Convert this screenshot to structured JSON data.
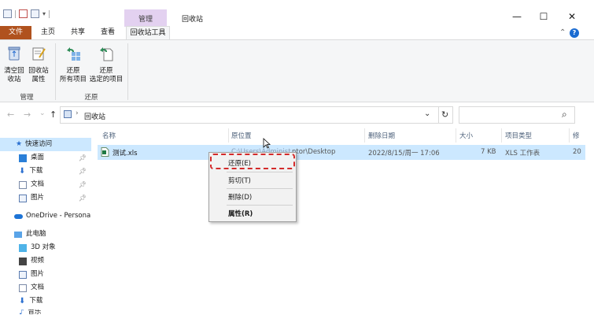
{
  "window": {
    "title": "回收站",
    "context_tab": "管理",
    "minimize": "—",
    "maximize": "☐",
    "close": "✕"
  },
  "tabs": {
    "file": "文件",
    "home": "主页",
    "share": "共享",
    "view": "查看",
    "recycle_tools": "回收站工具"
  },
  "ribbon": {
    "empty_bin": [
      "清空回",
      "收站"
    ],
    "bin_props": [
      "回收站",
      "属性"
    ],
    "restore_all": [
      "还原",
      "所有项目"
    ],
    "restore_selected": [
      "还原",
      "选定的项目"
    ],
    "group_manage": "管理",
    "group_restore": "还原",
    "collapse": "⌃",
    "help": "?"
  },
  "address": {
    "back": "←",
    "forward": "→",
    "recent": "⌄",
    "up": "↑",
    "path": "回收站",
    "dropdown": "⌄",
    "refresh": "↻",
    "search_icon": "⌕"
  },
  "nav": {
    "quick_access": "快速访问",
    "desktop": "桌面",
    "downloads": "下载",
    "documents": "文档",
    "pictures": "图片",
    "onedrive": "OneDrive - Persona",
    "this_pc": "此电脑",
    "objects3d": "3D 对象",
    "videos": "视频",
    "pictures2": "图片",
    "documents2": "文档",
    "downloads2": "下载",
    "music_partial": "音乐"
  },
  "columns": {
    "name": "名称",
    "original_location": "原位置",
    "date_deleted": "删除日期",
    "size": "大小",
    "item_type": "项目类型",
    "modified_partial": "修"
  },
  "file": {
    "name": "测试.xls",
    "location": "C:\\Users\\Administrator\\Desktop",
    "location_visible": "ntor\\Desktop",
    "location_hidden": "C:\\Users\\Administ",
    "date": "2022/8/15/周一 17:06",
    "size": "7 KB",
    "type": "XLS 工作表",
    "modified_partial": "20"
  },
  "context_menu": {
    "restore": "还原(E)",
    "cut": "剪切(T)",
    "delete": "删除(D)",
    "properties": "属性(R)"
  },
  "colors": {
    "file_tab": "#b0521e",
    "context_band": "#e3d1f0",
    "selection": "#cce8ff",
    "highlight_dash": "#d32b2b",
    "help_blue": "#1a6bd1"
  },
  "icons": {
    "empty_bin": "recycle-bin-icon",
    "bin_props": "properties-icon",
    "restore_all": "restore-all-icon",
    "restore_selected": "restore-selected-icon",
    "xls": "excel-file-icon"
  }
}
